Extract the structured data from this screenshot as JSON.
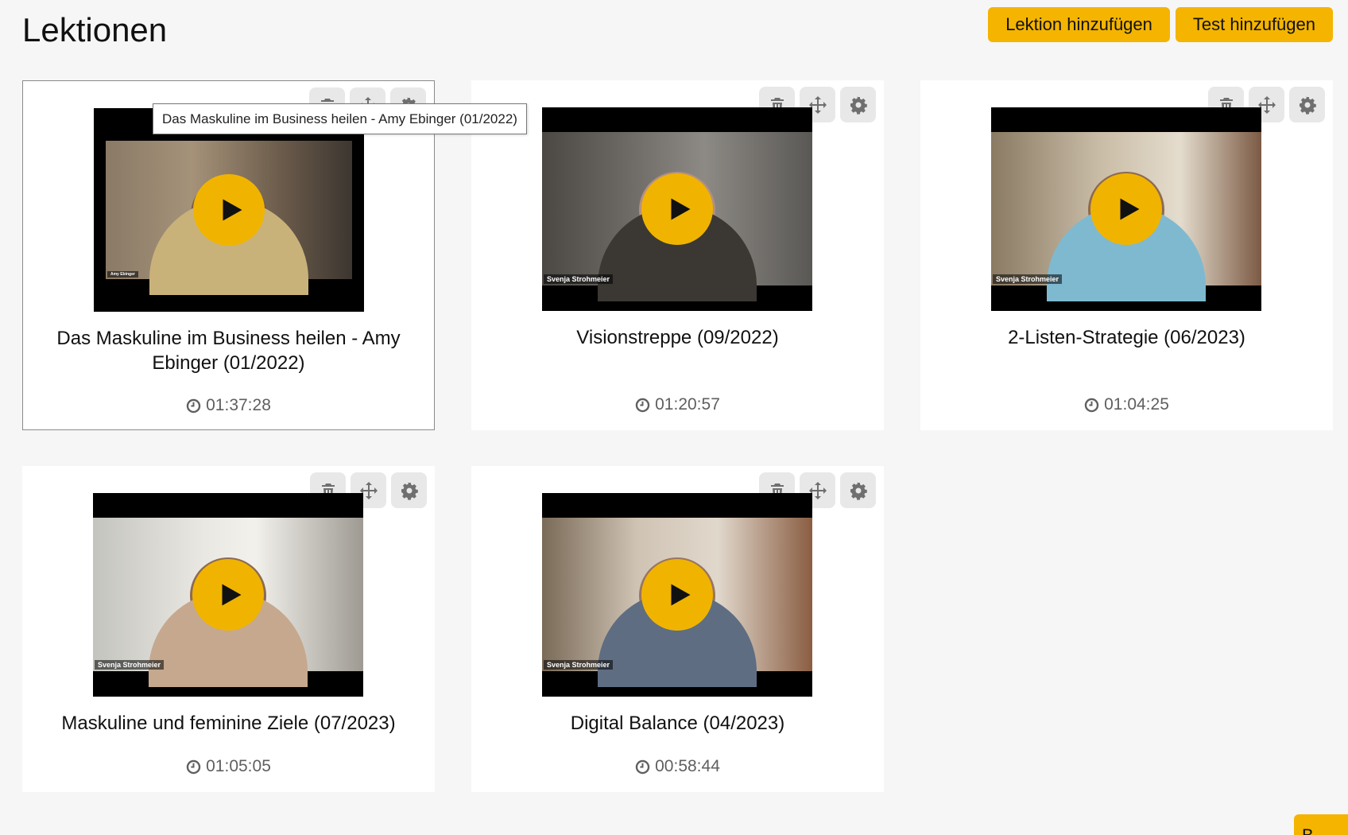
{
  "header": {
    "title": "Lektionen",
    "add_lesson_label": "Lektion hinzufügen",
    "add_test_label": "Test hinzufügen"
  },
  "tooltip": "Das Maskuline im Business heilen - Amy Ebinger (01/2022)",
  "lessons": [
    {
      "title": "Das Maskuline im Business heilen - Amy Ebinger (01/2022)",
      "duration": "01:37:28",
      "name_tag": "Amy Ebinger"
    },
    {
      "title": "Visionstreppe (09/2022)",
      "duration": "01:20:57",
      "name_tag": "Svenja Strohmeier"
    },
    {
      "title": "2-Listen-Strategie (06/2023)",
      "duration": "01:04:25",
      "name_tag": "Svenja Strohmeier"
    },
    {
      "title": "Maskuline und feminine Ziele (07/2023)",
      "duration": "01:05:05",
      "name_tag": "Svenja Strohmeier"
    },
    {
      "title": "Digital Balance (04/2023)",
      "duration": "00:58:44",
      "name_tag": "Svenja Strohmeier"
    }
  ],
  "icons": {
    "delete": "trash-icon",
    "move": "move-icon",
    "settings": "gear-icon",
    "play": "play-icon",
    "duration": "clock-icon"
  },
  "colors": {
    "accent": "#f4b400",
    "background": "#f6f6f6",
    "card": "#ffffff"
  },
  "corner_button_label": "B"
}
